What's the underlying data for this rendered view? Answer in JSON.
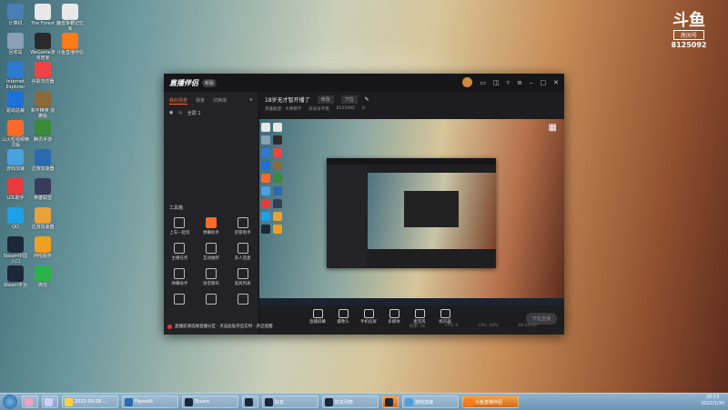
{
  "desktop": {
    "icons": [
      {
        "label": "计算机",
        "icon": "computer-icon",
        "color": "#4a7fb5"
      },
      {
        "label": "The Forest",
        "icon": "document-icon",
        "color": "#e8e8e8"
      },
      {
        "label": "魔兽争霸记忆库",
        "icon": "document-icon",
        "color": "#e8e8e8"
      },
      {
        "label": "回收站",
        "icon": "recycle-bin-icon",
        "color": "#8aa0b5"
      },
      {
        "label": "WeGame游戏管家",
        "icon": "wegame-icon",
        "color": "#2a2a2a"
      },
      {
        "label": "斗鱼直播伴侣",
        "icon": "douyu-icon",
        "color": "#ff7a1a"
      },
      {
        "label": "Internet Explorer",
        "icon": "ie-icon",
        "color": "#2d7bd1"
      },
      {
        "label": "谷歌浏览器",
        "icon": "chrome-icon",
        "color": "#e44"
      },
      {
        "label": "",
        "icon": "app-icon",
        "color": "#ffffff"
      },
      {
        "label": "驱动总裁",
        "icon": "driver-icon",
        "color": "#1e6fd9"
      },
      {
        "label": "和平精英 前瞻版",
        "icon": "game-icon",
        "color": "#8a6a3a"
      },
      {
        "label": "",
        "icon": "app-icon",
        "color": "#ffffff"
      },
      {
        "label": "山火短视频精灵版",
        "icon": "video-icon",
        "color": "#ff6a2a"
      },
      {
        "label": "腾讯手游",
        "icon": "game-icon",
        "color": "#3a8a3a"
      },
      {
        "label": "",
        "icon": "app-icon",
        "color": "#ffffff"
      },
      {
        "label": "游戏加速",
        "icon": "cloud-icon",
        "color": "#4aa0e0"
      },
      {
        "label": "迅游加速器",
        "icon": "accelerator-icon",
        "color": "#2a6ab0"
      },
      {
        "label": "",
        "icon": "app-icon",
        "color": "#ffffff"
      },
      {
        "label": "LOL助手",
        "icon": "lol-icon",
        "color": "#e83a3a"
      },
      {
        "label": "英雄联盟",
        "icon": "league-icon",
        "color": "#3a3a5a"
      },
      {
        "label": "",
        "icon": "app-icon",
        "color": "#ffffff"
      },
      {
        "label": "QQ",
        "icon": "qq-icon",
        "color": "#1ea0e8"
      },
      {
        "label": "迅游加速器",
        "icon": "accelerator-icon",
        "color": "#e8a23a"
      },
      {
        "label": "",
        "icon": "app-icon",
        "color": "#ffffff"
      },
      {
        "label": "Steam中国入口",
        "icon": "steam-icon",
        "color": "#1b2838"
      },
      {
        "label": "阿啦服务",
        "icon": "w-icon",
        "color": "#f0a020"
      },
      {
        "label": "",
        "icon": "app-icon",
        "color": "#ffffff"
      },
      {
        "label": "Steam平台",
        "icon": "steam-icon",
        "color": "#1b2838"
      },
      {
        "label": "微信",
        "icon": "wechat-icon",
        "color": "#2ab24a"
      }
    ]
  },
  "corner_logo": {
    "glyph": "斗鱼",
    "tag": "房间号",
    "number": "8125092"
  },
  "app": {
    "brand": "直播伴侣",
    "version": "新版",
    "tabs": [
      "我的场景",
      "场景",
      "切换场"
    ],
    "scene_name": "全屏 1",
    "tools_title": "工具箱",
    "tools": [
      {
        "label": "上车一起玩",
        "hot": false
      },
      {
        "label": "弹幕助手",
        "hot": true
      },
      {
        "label": "房管助手",
        "hot": false
      },
      {
        "label": "主播任务",
        "hot": false
      },
      {
        "label": "互动抽奖",
        "hot": false
      },
      {
        "label": "多人连麦",
        "hot": false
      },
      {
        "label": "弹幕助手",
        "hot": false
      },
      {
        "label": "语音聊天",
        "hot": false
      },
      {
        "label": "道具列表",
        "hot": false
      },
      {
        "label": "",
        "hot": false
      },
      {
        "label": "",
        "hot": false
      },
      {
        "label": "",
        "hot": false
      }
    ],
    "header": {
      "room_title": "18岁无才智开播了",
      "edit": "修改",
      "category": "下拉",
      "sub": [
        "英雄联盟 · 大神教学",
        "房间号不错",
        "8125092",
        "0"
      ]
    },
    "controls": [
      {
        "label": "直播屏幕"
      },
      {
        "label": "摄像头"
      },
      {
        "label": "手机投屏"
      },
      {
        "label": "多媒体"
      },
      {
        "label": "麦克风"
      },
      {
        "label": "扬声器"
      }
    ],
    "go_live": "开始直播",
    "notice": "直播前请选择直播分区 · 点击此处开启实时 · 开启提醒",
    "stats": [
      "码率: 0k",
      "FPS: 0",
      "CPU: 00%",
      "00:00:00",
      "内存: 0%"
    ]
  },
  "taskbar": {
    "items": [
      {
        "label": "",
        "color": "#f0a0c0",
        "active": false
      },
      {
        "label": "",
        "color": "#d0d0ff",
        "active": false
      },
      {
        "label": "2022-09-28 ...",
        "color": "#ffd23a",
        "active": false
      },
      {
        "label": "Pipeedit",
        "color": "#2a6ab0",
        "active": false
      },
      {
        "label": "Steam",
        "color": "#1b2838",
        "active": false
      },
      {
        "label": "",
        "color": "#1b2838",
        "active": false
      },
      {
        "label": "好友",
        "color": "#1b2838",
        "active": false
      },
      {
        "label": "好友列表",
        "color": "#1b2838",
        "active": false
      },
      {
        "label": "",
        "color": "#1b2838",
        "active": true
      },
      {
        "label": "游戏加速",
        "color": "#4aa0e0",
        "active": false
      },
      {
        "label": "斗鱼直播伴侣",
        "color": "#ff7a1a",
        "active": true
      }
    ],
    "clock_time": "20:13",
    "clock_date": "2022/1/30"
  }
}
